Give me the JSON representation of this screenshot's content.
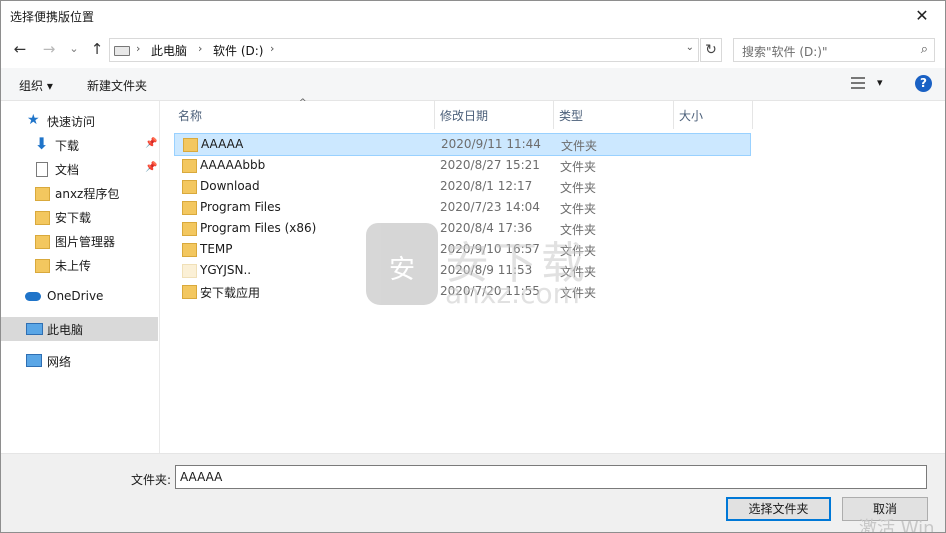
{
  "window": {
    "title": "选择便携版位置",
    "close_glyph": "✕"
  },
  "nav": {
    "back_glyph": "←",
    "forward_glyph": "→",
    "recent_glyph": "⌄",
    "up_glyph": "↑",
    "address": [
      "此电脑",
      "软件 (D:)"
    ],
    "address_sep": "›",
    "dropdown_glyph": "⌄",
    "refresh_glyph": "↻",
    "search_placeholder": "搜索\"软件 (D:)\"",
    "search_icon_glyph": "⌕"
  },
  "toolbar": {
    "organize": "组织 ▾",
    "new_folder": "新建文件夹",
    "view_dd_glyph": "▾",
    "help_glyph": "?"
  },
  "sidebar": {
    "items": [
      {
        "label": "快速访问",
        "icon": "star-icon",
        "glyph": "★"
      },
      {
        "label": "下载",
        "icon": "download-icon",
        "glyph": "⬇",
        "pinned": true
      },
      {
        "label": "文档",
        "icon": "document-icon",
        "pinned": true
      },
      {
        "label": "anxz程序包",
        "icon": "folder-icon"
      },
      {
        "label": "安下载",
        "icon": "folder-icon"
      },
      {
        "label": "图片管理器",
        "icon": "folder-icon"
      },
      {
        "label": "未上传",
        "icon": "folder-icon"
      },
      {
        "label": "OneDrive",
        "icon": "cloud-icon"
      },
      {
        "label": "此电脑",
        "icon": "computer-icon",
        "selected": true
      },
      {
        "label": "网络",
        "icon": "network-icon"
      }
    ],
    "pin_glyph": "📌"
  },
  "columns": {
    "name": "名称",
    "date": "修改日期",
    "type": "类型",
    "size": "大小",
    "sort_glyph": "^"
  },
  "files": [
    {
      "name": "AAAAA",
      "date": "2020/9/11 11:44",
      "type": "文件夹",
      "selected": true
    },
    {
      "name": "AAAAAbbb",
      "date": "2020/8/27 15:21",
      "type": "文件夹"
    },
    {
      "name": "Download",
      "date": "2020/8/1 12:17",
      "type": "文件夹"
    },
    {
      "name": "Program Files",
      "date": "2020/7/23 14:04",
      "type": "文件夹"
    },
    {
      "name": "Program Files (x86)",
      "date": "2020/8/4 17:36",
      "type": "文件夹"
    },
    {
      "name": "TEMP",
      "date": "2020/9/10 16:57",
      "type": "文件夹"
    },
    {
      "name": "YGYJSN..",
      "date": "2020/8/9 11:53",
      "type": "文件夹",
      "faded": true
    },
    {
      "name": "安下载应用",
      "date": "2020/7/20 11:55",
      "type": "文件夹"
    }
  ],
  "watermark": {
    "shield": "安",
    "cn": "安下载",
    "url": "anxz.com"
  },
  "bottom": {
    "folder_label": "文件夹:",
    "folder_value": "AAAAA",
    "select_button": "选择文件夹",
    "cancel_button": "取消",
    "activate_text": "激活 Win"
  }
}
